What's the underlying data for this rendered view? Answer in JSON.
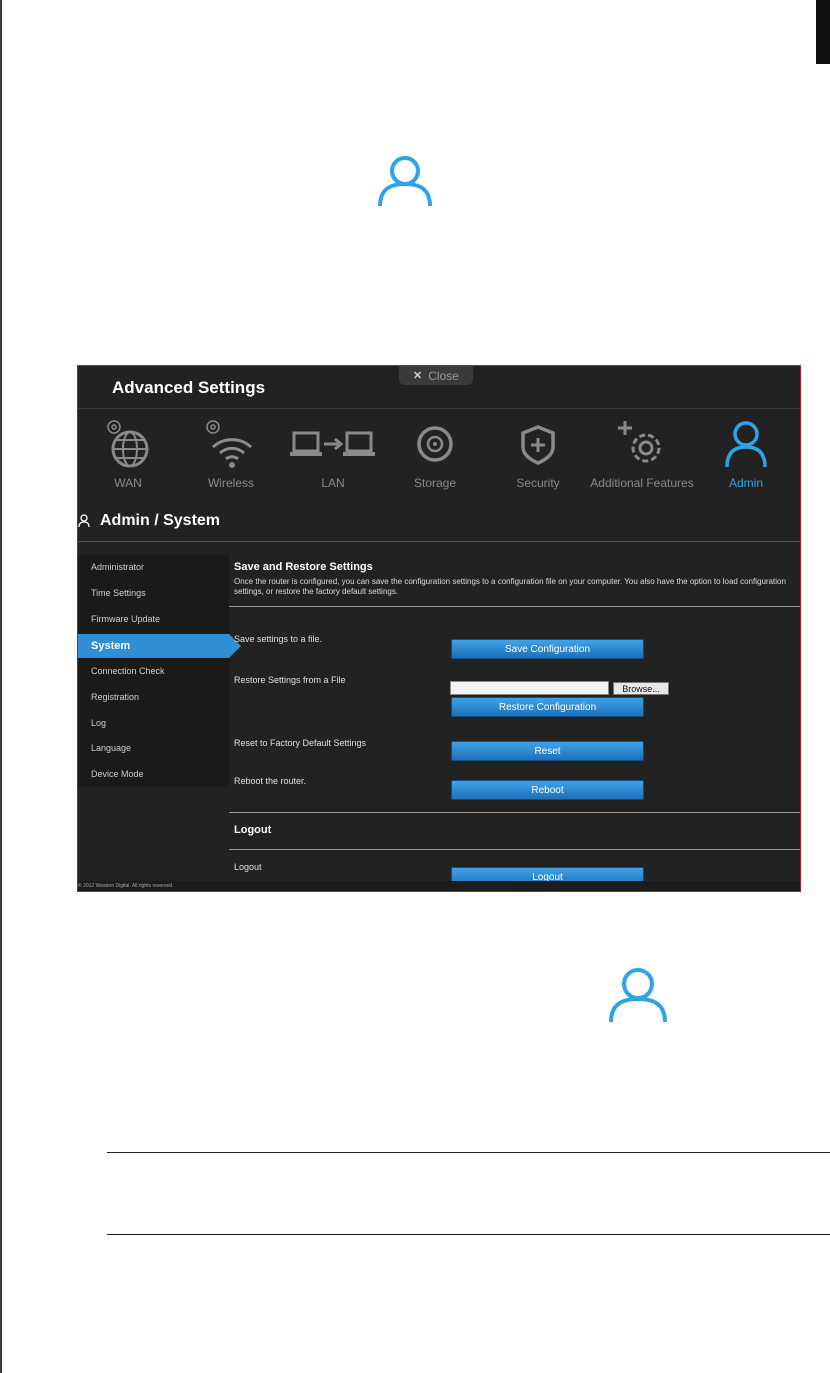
{
  "colors": {
    "accent": "#2ea3e6",
    "panel_bg": "#222222",
    "button_blue": "#2f8fd6",
    "panel_border": "#b02020"
  },
  "panel": {
    "title": "Advanced Settings",
    "close_label": "Close",
    "nav": [
      {
        "label": "WAN",
        "icon": "globe-gear-icon"
      },
      {
        "label": "Wireless",
        "icon": "wifi-gear-icon"
      },
      {
        "label": "LAN",
        "icon": "computers-arrow-icon"
      },
      {
        "label": "Storage",
        "icon": "disc-icon"
      },
      {
        "label": "Security",
        "icon": "shield-plus-icon"
      },
      {
        "label": "Additional Features",
        "icon": "gear-plus-icon"
      },
      {
        "label": "Admin",
        "icon": "user-icon",
        "active": true
      }
    ],
    "page_heading": "Admin / System",
    "sidebar": [
      {
        "label": "Administrator"
      },
      {
        "label": "Time Settings"
      },
      {
        "label": "Firmware Update"
      },
      {
        "label": "System",
        "active": true
      },
      {
        "label": "Connection Check"
      },
      {
        "label": "Registration"
      },
      {
        "label": "Log"
      },
      {
        "label": "Language"
      },
      {
        "label": "Device Mode"
      }
    ],
    "save_restore": {
      "title": "Save and Restore Settings",
      "description": "Once the router is configured, you can save the configuration settings to a configuration file on your computer. You also have the option to load configuration settings, or restore the factory default settings.",
      "save_label": "Save settings to a file.",
      "save_button": "Save Configuration",
      "restore_label": "Restore Settings from a File",
      "browse_button": "Browse...",
      "restore_button": "Restore Configuration",
      "reset_label": "Reset to Factory Default Settings",
      "reset_button": "Reset",
      "reboot_label": "Reboot the router.",
      "reboot_button": "Reboot"
    },
    "logout": {
      "title": "Logout",
      "label": "Logout",
      "button": "Logout"
    },
    "footer": "© 2012 Western Digital. All rights reserved."
  }
}
